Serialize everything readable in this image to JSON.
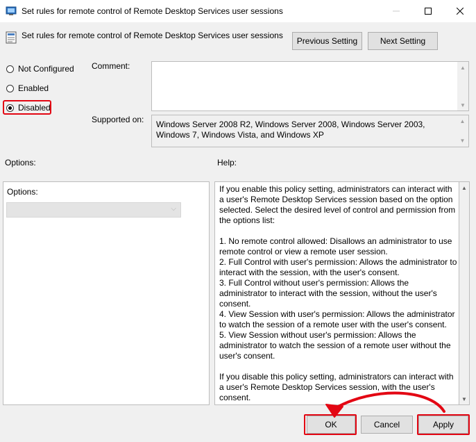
{
  "window": {
    "title": "Set rules for remote control of Remote Desktop Services user sessions",
    "minimize_icon": "minimize-icon",
    "maximize_icon": "maximize-icon",
    "close_icon": "close-icon"
  },
  "header": {
    "setting_title": "Set rules for remote control of Remote Desktop Services user sessions",
    "previous_label": "Previous Setting",
    "next_label": "Next Setting"
  },
  "state": {
    "options": [
      "Not Configured",
      "Enabled",
      "Disabled"
    ],
    "selected": "Disabled"
  },
  "comment": {
    "label": "Comment:",
    "value": ""
  },
  "supported": {
    "label": "Supported on:",
    "value": "Windows Server 2008 R2, Windows Server 2008, Windows Server 2003, Windows 7, Windows Vista, and Windows XP"
  },
  "options": {
    "heading": "Options:",
    "inner_label": "Options:",
    "dropdown_value": ""
  },
  "help": {
    "heading": "Help:",
    "text": "If you enable this policy setting, administrators can interact with a user's Remote Desktop Services session based on the option selected. Select the desired level of control and permission from the options list:\n\n1. No remote control allowed: Disallows an administrator to use remote control or view a remote user session.\n2. Full Control with user's permission: Allows the administrator to interact with the session, with the user's consent.\n3. Full Control without user's permission: Allows the administrator to interact with the session, without the user's consent.\n4. View Session with user's permission: Allows the administrator to watch the session of a remote user with the user's consent.\n5. View Session without user's permission: Allows the administrator to watch the session of a remote user without the user's consent.\n\nIf you disable this policy setting, administrators can interact with a user's Remote Desktop Services session, with the user's consent."
  },
  "footer": {
    "ok_label": "OK",
    "cancel_label": "Cancel",
    "apply_label": "Apply"
  },
  "colors": {
    "annotation": "#e30613",
    "button_face": "#e1e1e1",
    "dialog_bg": "#f0f0f0"
  }
}
